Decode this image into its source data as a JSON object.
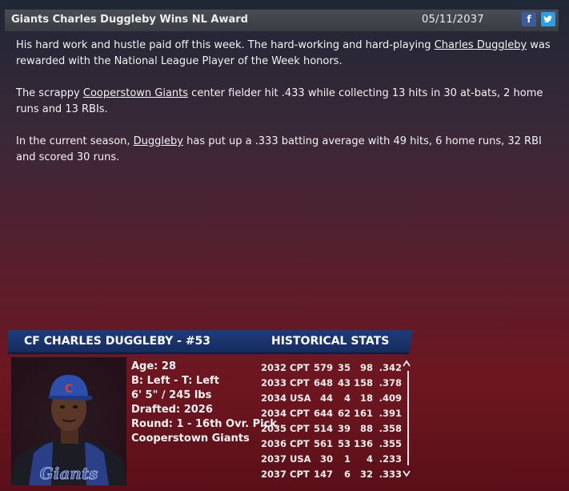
{
  "header": {
    "title": "Giants Charles Duggleby Wins NL Award",
    "date": "05/11/2037",
    "facebook_label": "f",
    "twitter_label": "t"
  },
  "article": {
    "p1_a": "His hard work and hustle paid off this week. The hard-working and hard-playing ",
    "p1_link": "Charles Duggleby",
    "p1_b": " was rewarded with the National League Player of the Week honors.",
    "p2_a": "The scrappy ",
    "p2_link": "Cooperstown Giants",
    "p2_b": " center fielder hit .433 while collecting 13 hits in 30 at-bats, 2 home runs and 13 RBIs.",
    "p3_a": "In the current season, ",
    "p3_link": "Duggleby",
    "p3_b": " has put up a .333 batting average with 49 hits, 6 home runs, 32 RBI and scored 30 runs."
  },
  "player": {
    "header_name": "CF CHARLES DUGGLEBY - #53",
    "header_stats": "HISTORICAL STATS",
    "age": "Age: 28",
    "bats_throws": "B: Left - T: Left",
    "height_weight": "6' 5\" / 245 lbs",
    "drafted": "Drafted: 2026",
    "round": "Round: 1 - 16th Ovr. Pick",
    "team": "Cooperstown Giants",
    "cap_letter": "C",
    "jersey_text": "Giants"
  },
  "stats": {
    "rows": [
      [
        "2032",
        "CPT",
        "579",
        "35",
        "98",
        ".342"
      ],
      [
        "2033",
        "CPT",
        "648",
        "43",
        "158",
        ".378"
      ],
      [
        "2034",
        "USA",
        "44",
        "4",
        "18",
        ".409"
      ],
      [
        "2034",
        "CPT",
        "644",
        "62",
        "161",
        ".391"
      ],
      [
        "2035",
        "CPT",
        "514",
        "39",
        "88",
        ".358"
      ],
      [
        "2036",
        "CPT",
        "561",
        "53",
        "136",
        ".355"
      ],
      [
        "2037",
        "USA",
        "30",
        "1",
        "4",
        ".233"
      ],
      [
        "2037",
        "CPT",
        "147",
        "6",
        "32",
        ".333"
      ]
    ],
    "scroll_up": "^",
    "scroll_down": "v"
  }
}
